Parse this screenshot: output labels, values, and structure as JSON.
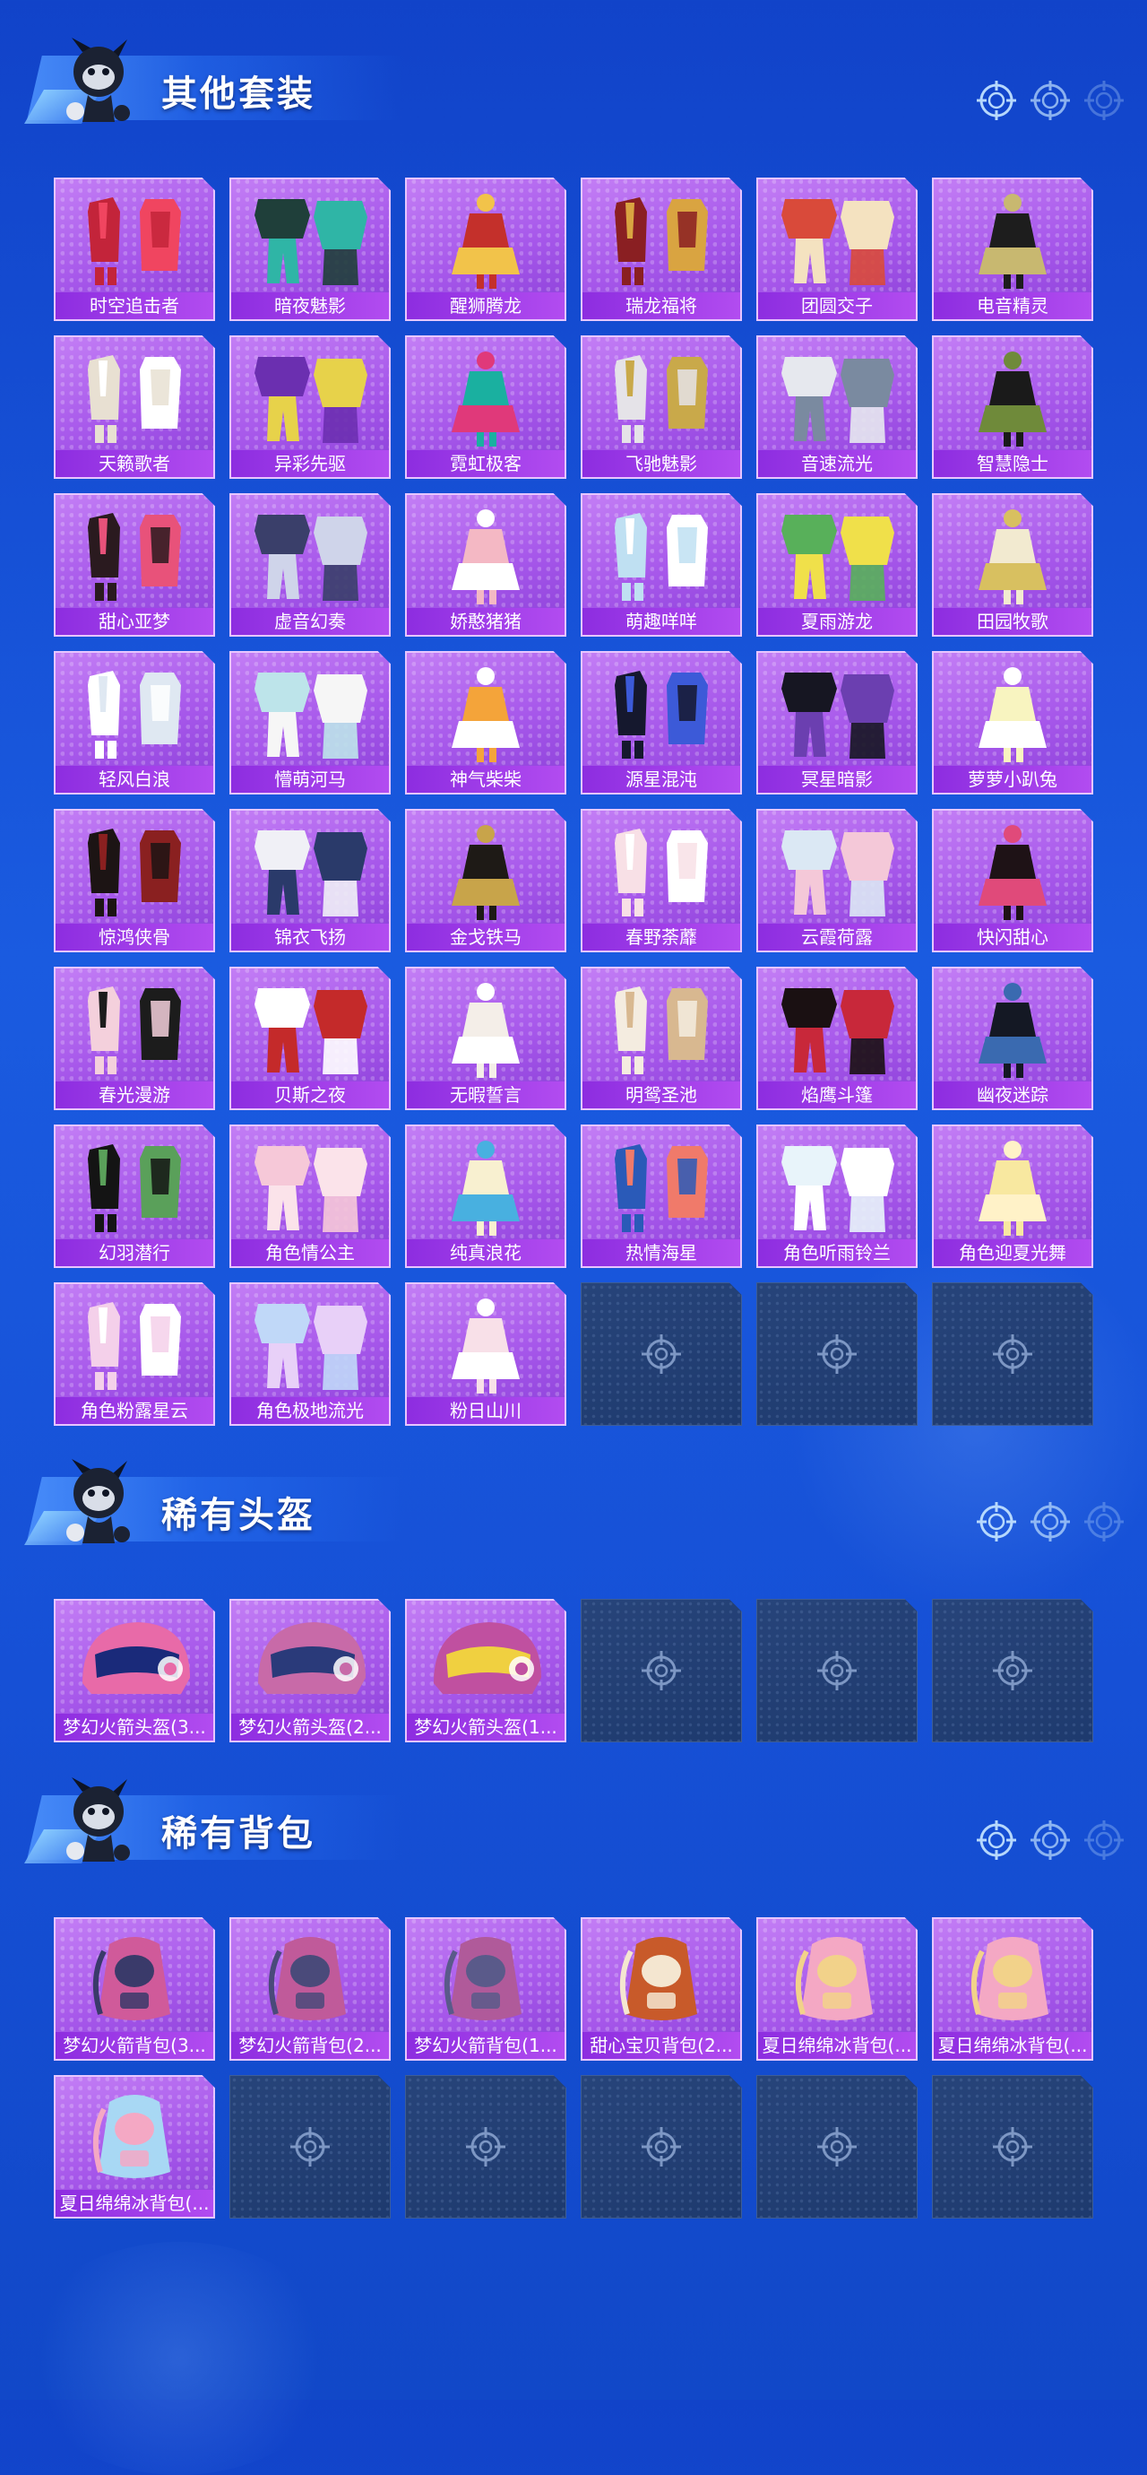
{
  "colors": {
    "accent": "#b24cf0",
    "card_bg": "#a657ea",
    "empty_bg": "#1e3a6e",
    "page_bg": "#1650d6"
  },
  "sections": [
    {
      "id": "suits",
      "title": "其他套装",
      "items": [
        {
          "label": "时空追击者",
          "palette": [
            "#c3243a",
            "#f04560"
          ]
        },
        {
          "label": "暗夜魅影",
          "palette": [
            "#1f3f3a",
            "#2fb5a6"
          ]
        },
        {
          "label": "醒狮腾龙",
          "palette": [
            "#c4302b",
            "#f2c34a"
          ]
        },
        {
          "label": "瑞龙福将",
          "palette": [
            "#8a1f22",
            "#d9a441"
          ]
        },
        {
          "label": "团圆交子",
          "palette": [
            "#d94a3a",
            "#f4e2c0"
          ]
        },
        {
          "label": "电音精灵",
          "palette": [
            "#1d1d1d",
            "#c8b870"
          ]
        },
        {
          "label": "天籁歌者",
          "palette": [
            "#e8e0d2",
            "#ffffff"
          ]
        },
        {
          "label": "异彩先驱",
          "palette": [
            "#6b2fb0",
            "#e7d24a"
          ]
        },
        {
          "label": "霓虹极客",
          "palette": [
            "#1ab0a0",
            "#e0397a"
          ]
        },
        {
          "label": "飞驰魅影",
          "palette": [
            "#e5e3e8",
            "#c9a94a"
          ]
        },
        {
          "label": "音速流光",
          "palette": [
            "#e6e8ee",
            "#7a8aa0"
          ]
        },
        {
          "label": "智慧隐士",
          "palette": [
            "#1a1a1a",
            "#6f8a3a"
          ]
        },
        {
          "label": "甜心亚梦",
          "palette": [
            "#2a1a1f",
            "#e8527a"
          ]
        },
        {
          "label": "虚音幻奏",
          "palette": [
            "#3a3f6a",
            "#cfd4ea"
          ]
        },
        {
          "label": "娇憨猪猪",
          "palette": [
            "#f4b8c4",
            "#ffffff"
          ]
        },
        {
          "label": "萌趣咩咩",
          "palette": [
            "#bfe0f2",
            "#ffffff"
          ]
        },
        {
          "label": "夏雨游龙",
          "palette": [
            "#58b05a",
            "#f0e04a"
          ]
        },
        {
          "label": "田园牧歌",
          "palette": [
            "#f2ead0",
            "#d8c060"
          ]
        },
        {
          "label": "轻风白浪",
          "palette": [
            "#ffffff",
            "#dfe8f2"
          ]
        },
        {
          "label": "懵萌河马",
          "palette": [
            "#bde4ea",
            "#f6f6f6"
          ]
        },
        {
          "label": "神气柴柴",
          "palette": [
            "#f4a43a",
            "#ffffff"
          ]
        },
        {
          "label": "源星混沌",
          "palette": [
            "#15182e",
            "#3c5ad8"
          ]
        },
        {
          "label": "冥星暗影",
          "palette": [
            "#161622",
            "#6b3fb0"
          ]
        },
        {
          "label": "萝萝小趴兔",
          "palette": [
            "#f8f4c0",
            "#ffffff"
          ]
        },
        {
          "label": "惊鸿侠骨",
          "palette": [
            "#1c1414",
            "#8a2020"
          ]
        },
        {
          "label": "锦衣飞扬",
          "palette": [
            "#f0f0f6",
            "#2a3a6a"
          ]
        },
        {
          "label": "金戈铁马",
          "palette": [
            "#1e1a16",
            "#c8a44a"
          ]
        },
        {
          "label": "春野荼蘼",
          "palette": [
            "#f8e0e6",
            "#ffffff"
          ]
        },
        {
          "label": "云霞荷露",
          "palette": [
            "#dbe8f4",
            "#f4c8d8"
          ]
        },
        {
          "label": "快闪甜心",
          "palette": [
            "#1e1216",
            "#e04a7a"
          ]
        },
        {
          "label": "春光漫游",
          "palette": [
            "#f4d0dc",
            "#1c1c1c"
          ]
        },
        {
          "label": "贝斯之夜",
          "palette": [
            "#ffffff",
            "#c42a2a"
          ]
        },
        {
          "label": "无暇誓言",
          "palette": [
            "#f4eee8",
            "#ffffff"
          ]
        },
        {
          "label": "明鸳圣池",
          "palette": [
            "#f4ece0",
            "#d8b890"
          ]
        },
        {
          "label": "焰鹰斗篷",
          "palette": [
            "#1a1012",
            "#c8283a"
          ]
        },
        {
          "label": "幽夜迷踪",
          "palette": [
            "#141824",
            "#3a6ab0"
          ]
        },
        {
          "label": "幻羽潜行",
          "palette": [
            "#141414",
            "#5aa05a"
          ]
        },
        {
          "label": "角色情公主",
          "palette": [
            "#f6c8d8",
            "#fbe3ea"
          ]
        },
        {
          "label": "纯真浪花",
          "palette": [
            "#f8f0d0",
            "#48b0e0"
          ]
        },
        {
          "label": "热情海星",
          "palette": [
            "#2a5ab8",
            "#f07a6a"
          ]
        },
        {
          "label": "角色听雨铃兰",
          "palette": [
            "#e8f4fa",
            "#ffffff"
          ]
        },
        {
          "label": "角色迎夏光舞",
          "palette": [
            "#f8e8a0",
            "#fff2c8"
          ]
        },
        {
          "label": "角色粉露星云",
          "palette": [
            "#f4d0ea",
            "#ffffff"
          ]
        },
        {
          "label": "角色极地流光",
          "palette": [
            "#c0d8f8",
            "#e8d0f8"
          ]
        },
        {
          "label": "粉日山川",
          "palette": [
            "#f8e0e8",
            "#ffffff"
          ]
        }
      ],
      "empty_slots": 3
    },
    {
      "id": "helmets",
      "title": "稀有头盔",
      "items": [
        {
          "label": "梦幻火箭头盔(3...",
          "palette": [
            "#e86aa8",
            "#1a2a7a"
          ]
        },
        {
          "label": "梦幻火箭头盔(2...",
          "palette": [
            "#c86aa8",
            "#2a3a7a"
          ]
        },
        {
          "label": "梦幻火箭头盔(1...",
          "palette": [
            "#c050a0",
            "#f0d040"
          ]
        }
      ],
      "empty_slots": 3
    },
    {
      "id": "backpacks",
      "title": "稀有背包",
      "items": [
        {
          "label": "梦幻火箭背包(3...",
          "palette": [
            "#d05a9a",
            "#3a3a6a"
          ]
        },
        {
          "label": "梦幻火箭背包(2...",
          "palette": [
            "#c05a9a",
            "#4a4a7a"
          ]
        },
        {
          "label": "梦幻火箭背包(1...",
          "palette": [
            "#b05a9a",
            "#5a5a8a"
          ]
        },
        {
          "label": "甜心宝贝背包(2...",
          "palette": [
            "#c85a2a",
            "#f4e6d0"
          ]
        },
        {
          "label": "夏日绵绵冰背包(...",
          "palette": [
            "#f4a8c4",
            "#f2d28a"
          ]
        },
        {
          "label": "夏日绵绵冰背包(...",
          "palette": [
            "#f4a8c4",
            "#f2d28a"
          ]
        },
        {
          "label": "夏日绵绵冰背包(...",
          "palette": [
            "#a8d8f4",
            "#f4a8c4"
          ]
        }
      ],
      "empty_slots": 5
    }
  ]
}
